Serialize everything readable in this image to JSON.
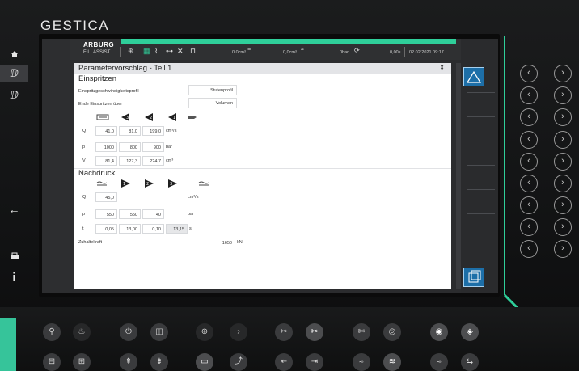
{
  "brand": "GESTICA",
  "header": {
    "logo": "ARBURG",
    "assist": "FILLASSIST",
    "values": [
      "0,0cm³",
      "0,0cm³",
      "0bar",
      "0,00s"
    ],
    "datetime": "02.02.2021  09:17"
  },
  "nav": {
    "home_icon": "home-icon",
    "items": [
      "ⅅ",
      "ⅅ"
    ],
    "back_icon": "arrow-left-icon",
    "info": "i"
  },
  "panel": {
    "title": "Parametervorschlag - Teil 1",
    "einspritzen": {
      "heading": "Einspritzen",
      "profile_label": "Einspritzgeschwindigkeitsprofil",
      "profile_value": "Stufenprofil",
      "end_label": "Ende Einspritzen über",
      "end_value": "Volumen",
      "rows": [
        {
          "key": "Q",
          "values": [
            "41,0",
            "81,0",
            "199,0"
          ],
          "unit": "cm³/s"
        },
        {
          "key": "p",
          "values": [
            "1000",
            "800",
            "900"
          ],
          "unit": "bar"
        },
        {
          "key": "V",
          "values": [
            "81,4",
            "127,3",
            "224,7"
          ],
          "unit": "cm³"
        }
      ]
    },
    "nachdruck": {
      "heading": "Nachdruck",
      "rows": [
        {
          "key": "Q",
          "values": [
            "45,0"
          ],
          "unit": "cm³/s"
        },
        {
          "key": "p",
          "values": [
            "550",
            "550",
            "40"
          ],
          "unit": "bar"
        },
        {
          "key": "t",
          "values": [
            "0,05",
            "13,00",
            "0,10",
            "13,15"
          ],
          "unit": "s"
        }
      ]
    },
    "zuhaltekraft": {
      "label": "Zuhaltekraft",
      "value": "1650",
      "unit": "kN"
    }
  },
  "colors": {
    "accent": "#2fcf9a",
    "highlight": "#1d6fa8"
  }
}
